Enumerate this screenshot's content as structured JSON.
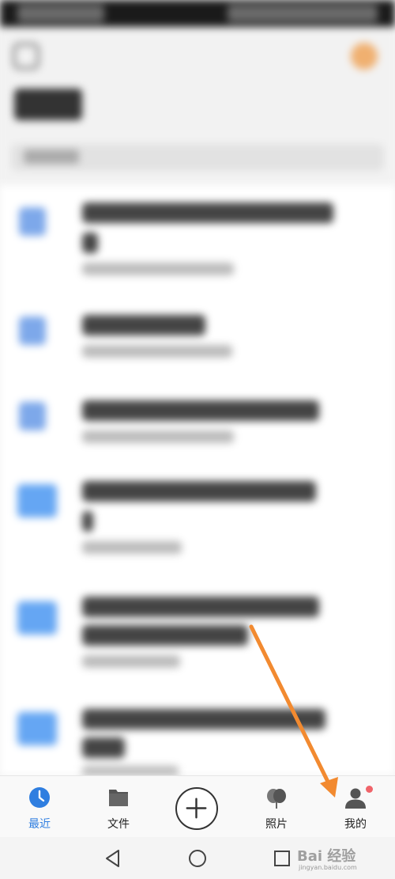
{
  "bottom_nav": {
    "items": [
      {
        "label": "最近",
        "icon": "clock-icon",
        "active": true
      },
      {
        "label": "文件",
        "icon": "folder-icon",
        "active": false
      },
      {
        "label": "照片",
        "icon": "photos-icon",
        "active": false
      },
      {
        "label": "我的",
        "icon": "person-icon",
        "active": false,
        "badge": true
      }
    ],
    "add_icon": "plus-circle-icon"
  },
  "watermark": {
    "text": "Bai 经验",
    "sub": "jingyan.baidu.com"
  },
  "colors": {
    "accent": "#2f7ee0",
    "badge": "#f0646a",
    "arrow": "#f28a30",
    "file_icon": "#7da8ea",
    "folder_icon": "#65a6f3"
  }
}
